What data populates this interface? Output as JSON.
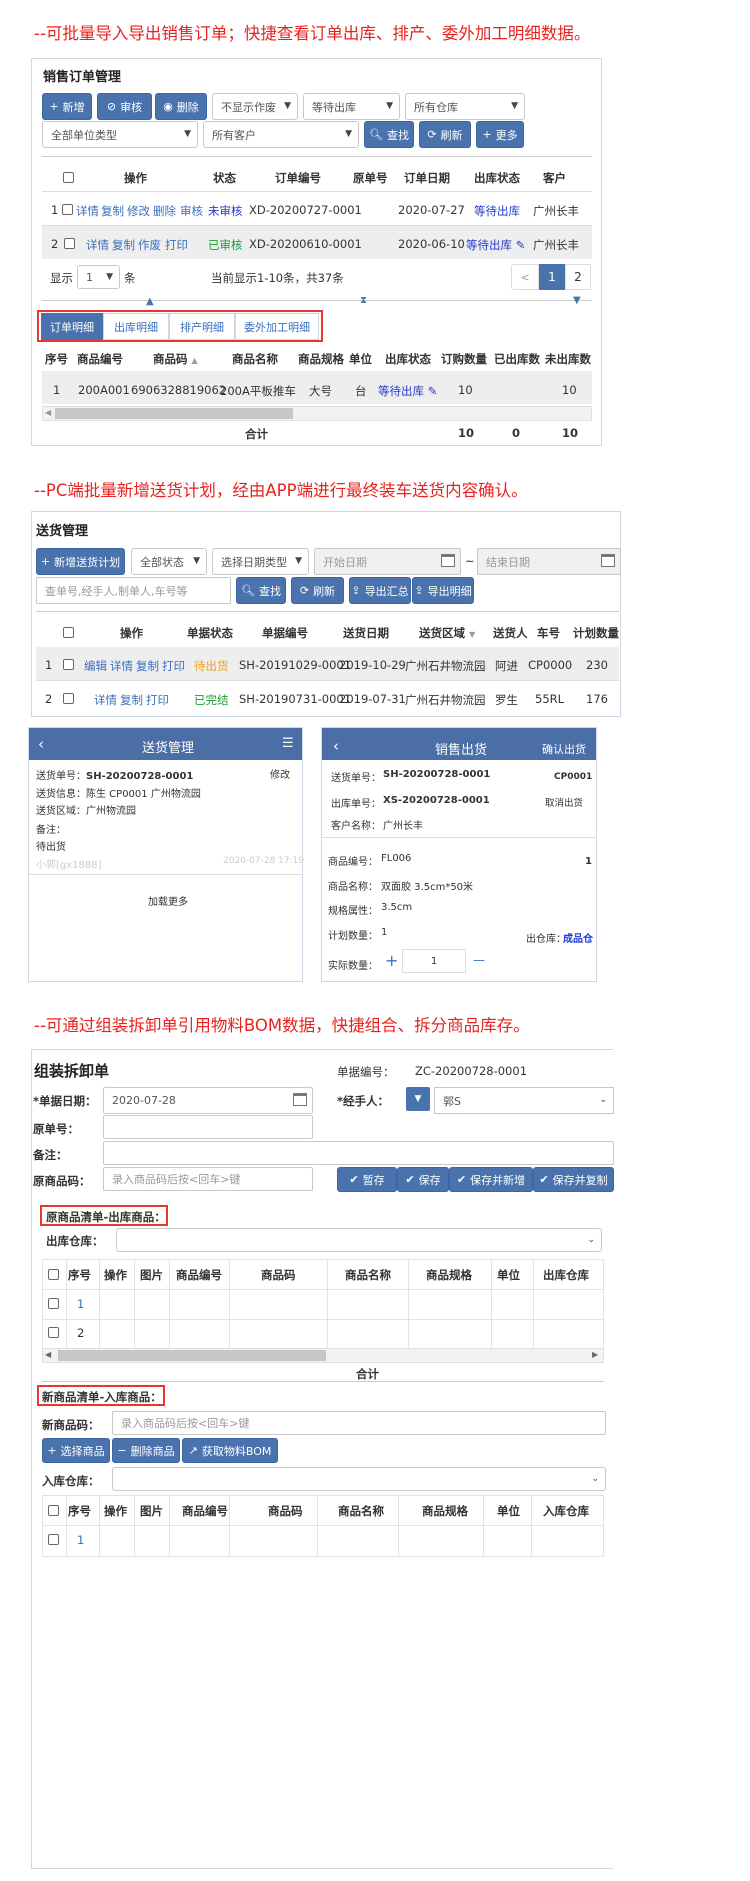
{
  "headings": {
    "h1": "--可批量导入导出销售订单；快捷查看订单出库、排产、委外加工明细数据。",
    "h2": "--PC端批量新增送货计划，经由APP端进行最终装车送货内容确认。",
    "h3": "--可通过组装拆卸单引用物料BOM数据，快捷组合、拆分商品库存。"
  },
  "sales": {
    "title": "销售订单管理",
    "buttons": {
      "add": "新增",
      "audit": "审核",
      "delete": "删除",
      "search": "查找",
      "refresh": "刷新",
      "more": "更多"
    },
    "filters": {
      "void": "不显示作废",
      "outbound": "等待出库",
      "warehouse": "所有仓库",
      "unit_type": "全部单位类型",
      "customer": "所有客户"
    },
    "columns": [
      "操作",
      "状态",
      "订单编号",
      "原单号",
      "订单日期",
      "出库状态",
      "客户"
    ],
    "rows": [
      {
        "no": "1",
        "ops": [
          "详情",
          "复制",
          "修改",
          "删除",
          "审核"
        ],
        "status": "未审核",
        "order_no": "XD-20200727-0001",
        "orig": "",
        "date": "2020-07-27",
        "out_status": "等待出库",
        "customer": "广州长丰"
      },
      {
        "no": "2",
        "ops": [
          "详情",
          "复制",
          "作废",
          "打印"
        ],
        "status": "已审核",
        "order_no": "XD-20200610-0001",
        "orig": "",
        "date": "2020-06-10",
        "out_status": "等待出库",
        "customer": "广州长丰"
      }
    ],
    "pagination": {
      "show": "显示",
      "size": "1",
      "unit": "条",
      "info": "当前显示1-10条，共37条",
      "prev": "<",
      "pages": [
        "1",
        "2"
      ],
      "current": "1"
    },
    "tabs": [
      "订单明细",
      "出库明细",
      "排产明细",
      "委外加工明细"
    ],
    "active_tab": "订单明细",
    "detail_columns": [
      "序号",
      "商品编号",
      "商品码",
      "商品名称",
      "商品规格",
      "单位",
      "出库状态",
      "订购数量",
      "已出库数",
      "未出库数"
    ],
    "detail_row": {
      "no": "1",
      "code": "200A001",
      "barcode": "6906328819062",
      "name": "200A平板推车",
      "spec": "大号",
      "unit": "台",
      "status": "等待出库",
      "ordered": "10",
      "shipped": "",
      "remaining": "10"
    },
    "total": {
      "label": "合计",
      "ordered": "10",
      "shipped": "0",
      "remaining": "10"
    }
  },
  "delivery": {
    "title": "送货管理",
    "buttons": {
      "add": "新增送货计划",
      "search": "查找",
      "refresh": "刷新",
      "export_summary": "导出汇总",
      "export_detail": "导出明细"
    },
    "filters": {
      "status": "全部状态",
      "date_type": "选择日期类型",
      "start": "开始日期",
      "tilde": "~",
      "end": "结束日期",
      "keyword": "查单号,经手人,制单人,车号等"
    },
    "columns": [
      "操作",
      "单据状态",
      "单据编号",
      "送货日期",
      "送货区域",
      "送货人",
      "车号",
      "计划数量"
    ],
    "rows": [
      {
        "no": "1",
        "ops": [
          "编辑",
          "详情",
          "复制",
          "打印"
        ],
        "status": "待出货",
        "doc_no": "SH-20191029-0001",
        "date": "2019-10-29",
        "area": "广州石井物流园",
        "person": "阿进",
        "car": "CP0000",
        "qty": "230"
      },
      {
        "no": "2",
        "ops": [
          "详情",
          "复制",
          "打印"
        ],
        "status": "已完结",
        "doc_no": "SH-20190731-0001",
        "date": "2019-07-31",
        "area": "广州石井物流园",
        "person": "罗生",
        "car": "55RL",
        "qty": "176"
      }
    ]
  },
  "mobile_left": {
    "title": "送货管理",
    "edit": "修改",
    "lines": [
      {
        "label": "送货单号：",
        "value": "SH-20200728-0001"
      },
      {
        "label": "送货信息：",
        "value": "陈生 CP0001 广州物流园"
      },
      {
        "label": "送货区域：",
        "value": "广州物流园"
      },
      {
        "label": "备注：",
        "value": ""
      }
    ],
    "status": "待出货",
    "user": "小郭[gx1888]",
    "time": "2020-07-28 17:19",
    "load_more": "加载更多"
  },
  "mobile_right": {
    "title": "销售出货",
    "confirm": "确认出货",
    "delivery_label": "送货单号：",
    "delivery_no": "SH-20200728-0001",
    "car": "CP0001",
    "out_label": "出库单号：",
    "out_no": "XS-20200728-0001",
    "cancel": "取消出货",
    "customer_label": "客户名称：",
    "customer": "广州长丰",
    "code_label": "商品编号：",
    "code": "FL006",
    "index": "1",
    "name_label": "商品名称：",
    "name": "双面胶 3.5cm*50米",
    "spec_label": "规格属性：",
    "spec": "3.5cm",
    "plan_label": "计划数量：",
    "plan": "1",
    "wh_label": "出仓库：",
    "wh": "成品仓",
    "actual_label": "实际数量：",
    "plus": "+",
    "actual": "1",
    "minus": "—"
  },
  "assembly": {
    "title": "组装拆卸单",
    "doc_label": "单据编号：",
    "doc_no": "ZC-20200728-0001",
    "date_label": "*单据日期：",
    "date": "2020-07-28",
    "handler_label": "*经手人：",
    "handler": "郭S",
    "orig_label": "原单号：",
    "note_label": "备注：",
    "orig_code_label": "原商品码：",
    "orig_code_placeholder": "录入商品码后按<回车>键",
    "buttons": {
      "save_draft": "暂存",
      "save": "保存",
      "save_new": "保存并新增",
      "save_copy": "保存并复制"
    },
    "orig_section": "原商品清单-出库商品：",
    "out_wh_label": "出库仓库：",
    "orig_columns": [
      "序号",
      "操作",
      "图片",
      "商品编号",
      "商品码",
      "商品名称",
      "商品规格",
      "单位",
      "出库仓库"
    ],
    "orig_rows": [
      "1",
      "2"
    ],
    "total": "合计",
    "new_section": "新商品清单-入库商品：",
    "new_code_label": "新商品码：",
    "new_code_placeholder": "录入商品码后按<回车>键",
    "new_buttons": {
      "select": "选择商品",
      "remove": "删除商品",
      "bom": "获取物料BOM"
    },
    "in_wh_label": "入库仓库：",
    "new_columns": [
      "序号",
      "操作",
      "图片",
      "商品编号",
      "商品码",
      "商品名称",
      "商品规格",
      "单位",
      "入库仓库"
    ],
    "new_rows": [
      "1"
    ]
  }
}
